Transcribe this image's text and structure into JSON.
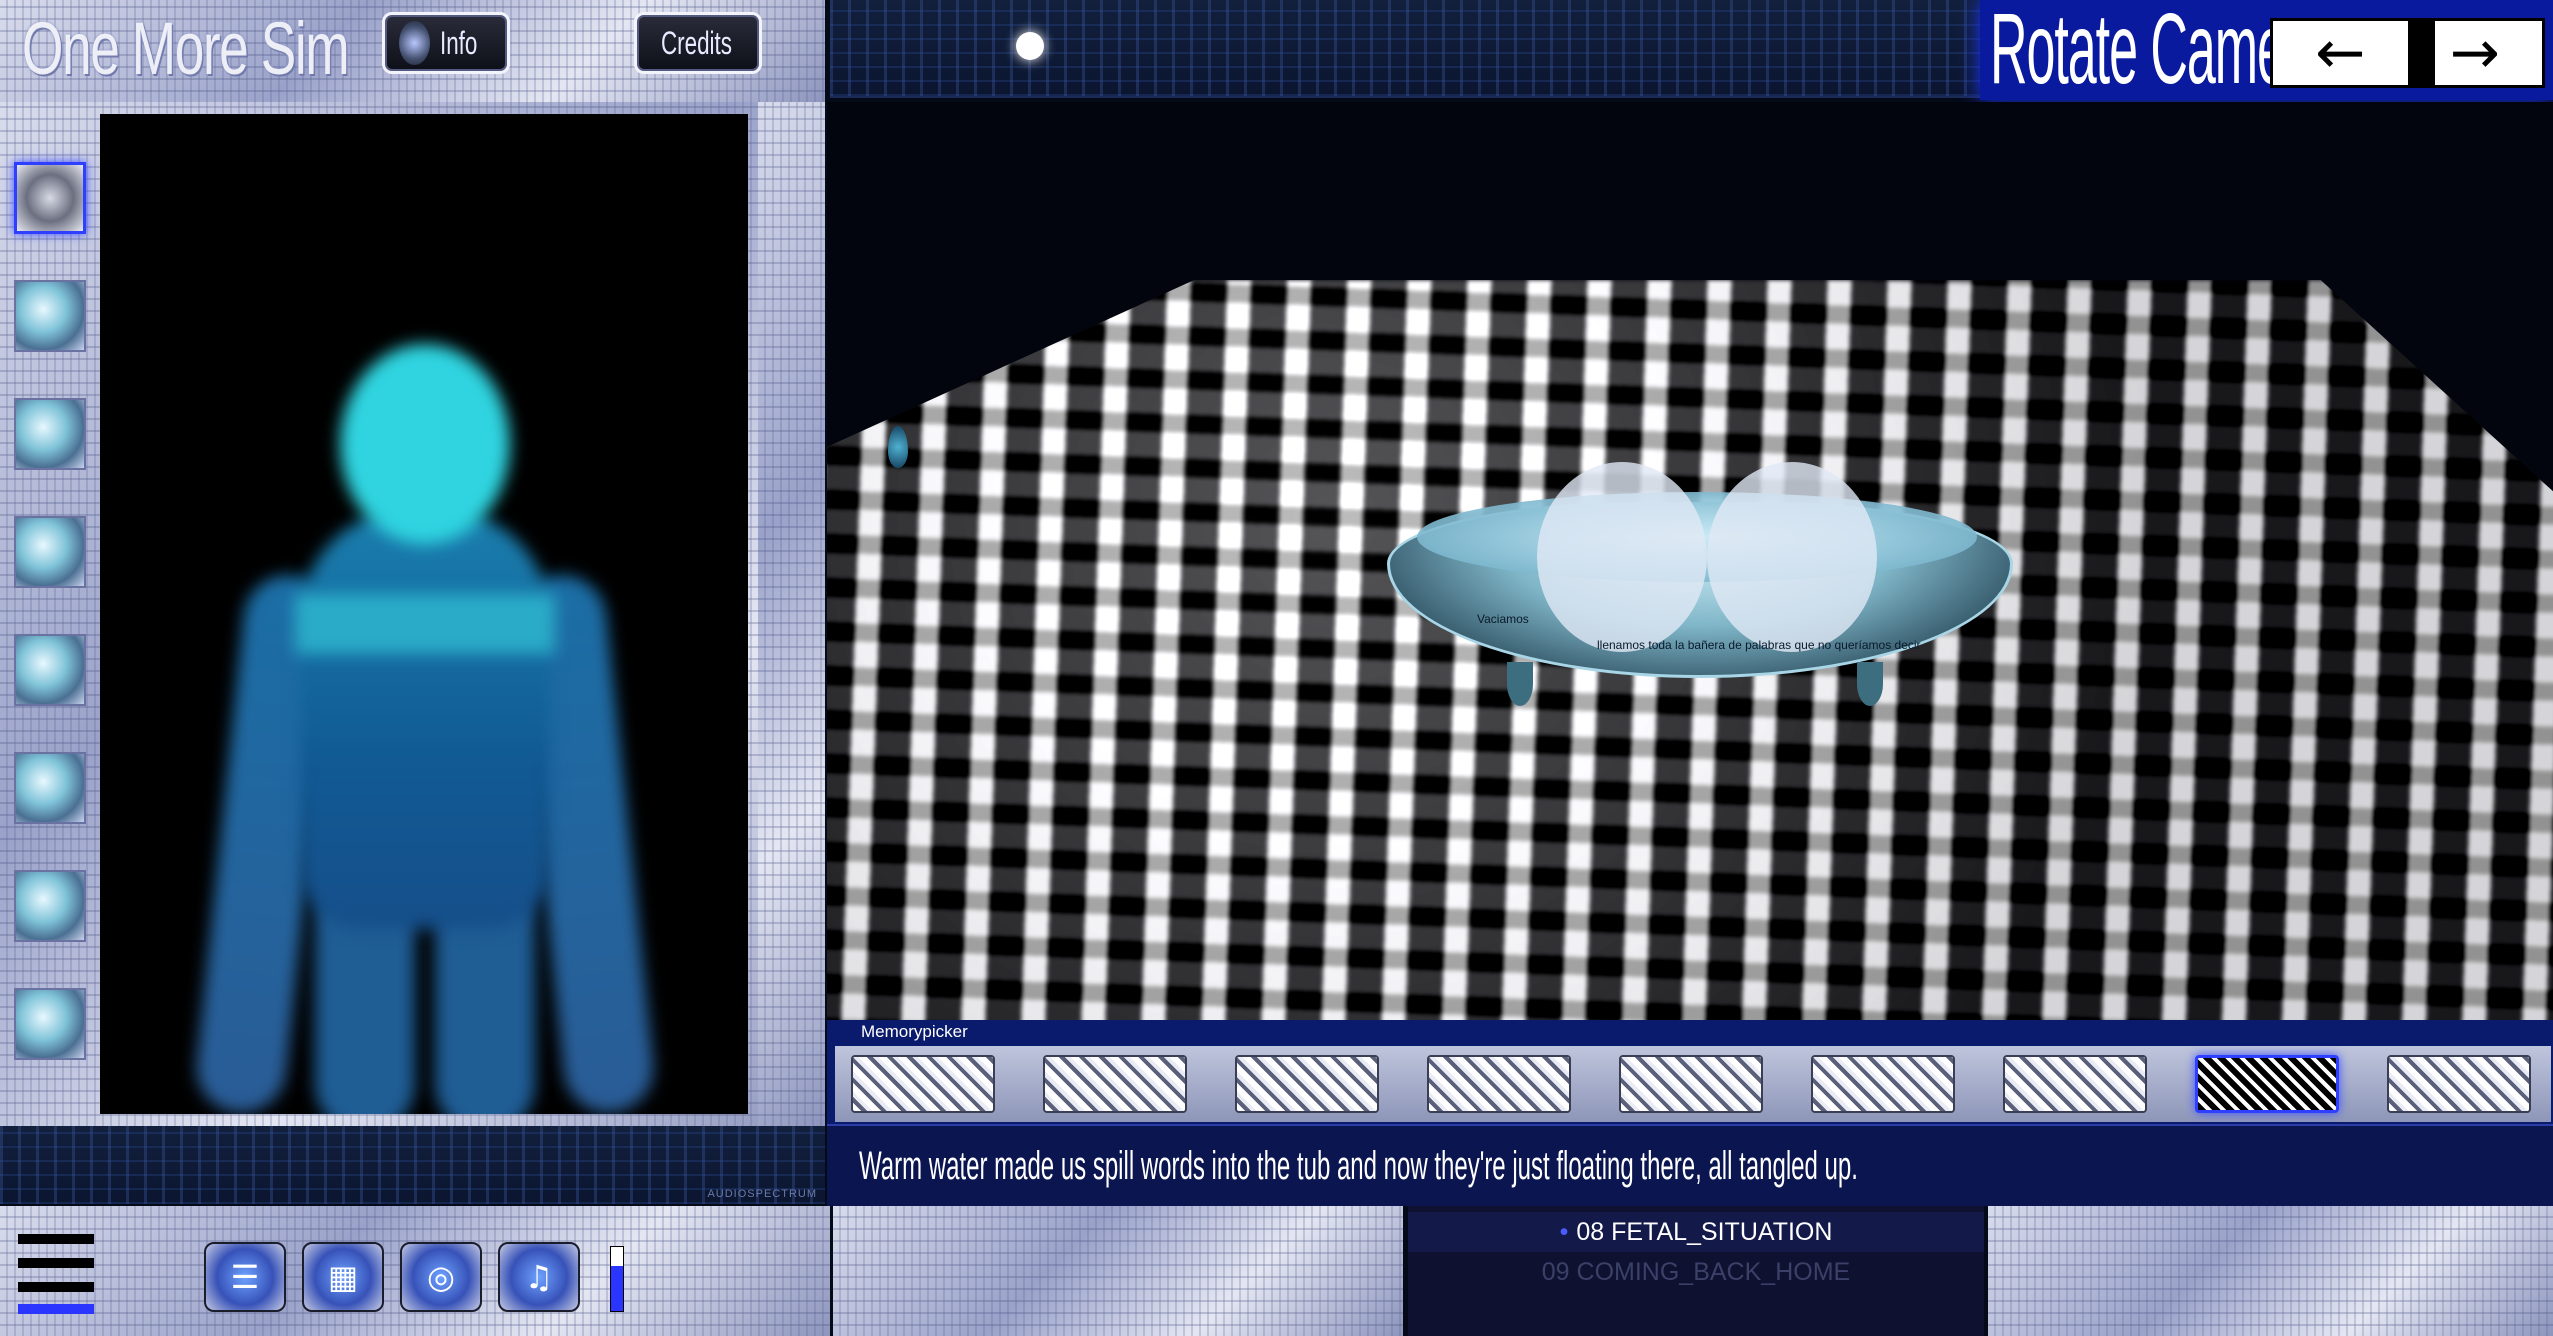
{
  "header": {
    "app_title": "One More Sim",
    "info_label": "Info",
    "credits_label": "Credits"
  },
  "camera": {
    "rotate_label": "Rotate Camera",
    "left_arrow": "←",
    "right_arrow": "→"
  },
  "memorypicker": {
    "label": "Memorypicker",
    "slot_count": 9,
    "selected_index": 8
  },
  "caption": "Warm water made us spill words into the tub and now they're just floating there, all tangled up.",
  "scene": {
    "tub_text_line1": "Vaciamos",
    "tub_text_line2": "llenamos toda la bañera de palabras que no queríamos decir"
  },
  "audio": {
    "label": "AUDIOSPECTRUM"
  },
  "tracks": {
    "current": "08 FETAL_SITUATION",
    "next": "09 COMING_BACK_HOME",
    "current_marker": "•"
  },
  "colors": {
    "accent_blue": "#2a36ff",
    "panel_navy": "#0b1650",
    "figure_cyan": "#2fd4e0"
  }
}
